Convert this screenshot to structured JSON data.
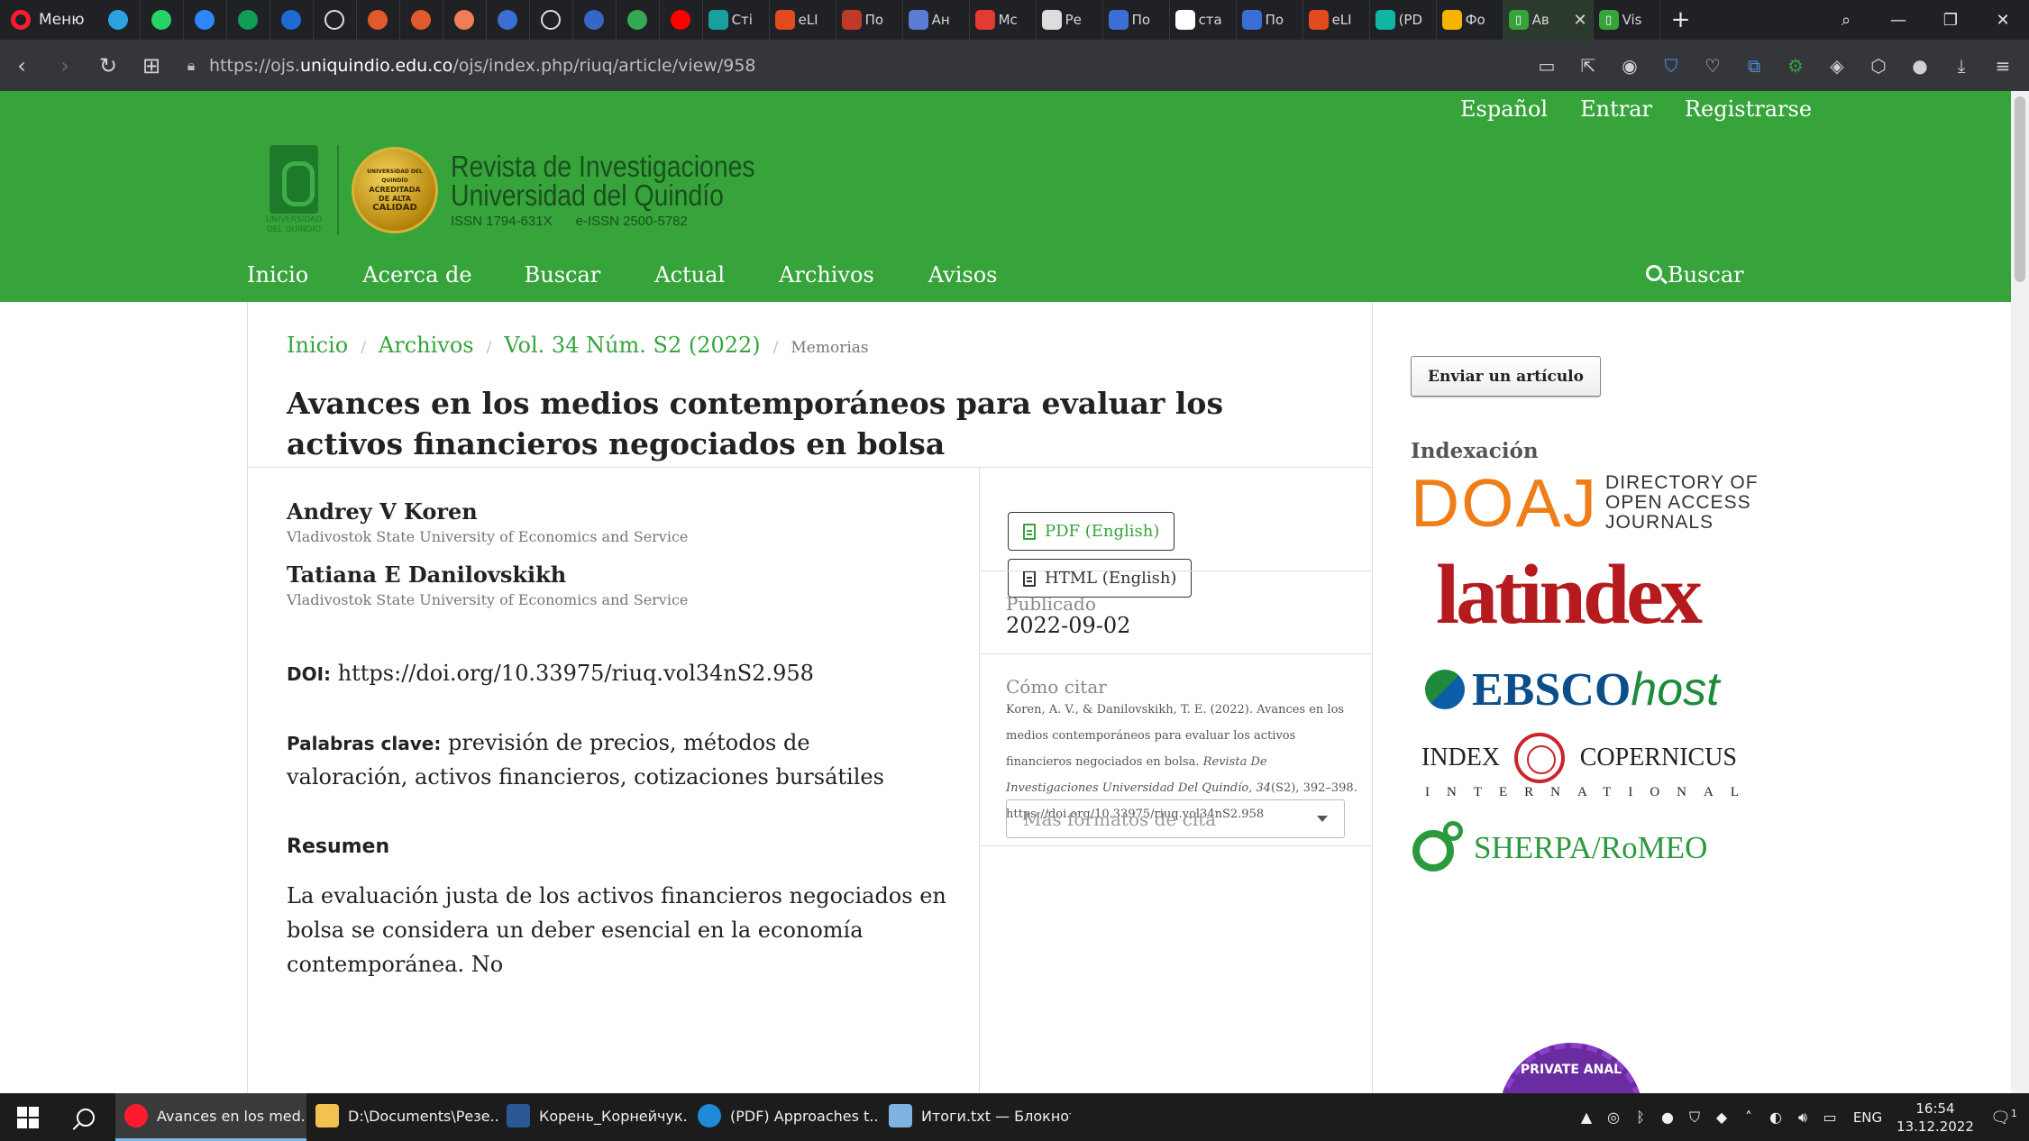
{
  "browser": {
    "menu_label": "Меню",
    "pinned_tabs": [
      {
        "icon": "telegram-icon",
        "color": "#2aa3de"
      },
      {
        "icon": "whatsapp-icon",
        "color": "#25d366"
      },
      {
        "icon": "messenger-icon",
        "color": "#2d88ff"
      },
      {
        "icon": "sheets-icon",
        "color": "#0f9d58"
      },
      {
        "icon": "stack-icon",
        "color": "#1e6bd6"
      },
      {
        "icon": "globe-icon",
        "color": "#ffffff"
      },
      {
        "icon": "feather-icon",
        "color": "#e05a2b"
      },
      {
        "icon": "feather-icon",
        "color": "#e05a2b"
      },
      {
        "icon": "rocket-icon",
        "color": "#f07e54"
      },
      {
        "icon": "banner-icon",
        "color": "#3b6fd6"
      },
      {
        "icon": "tradingview-icon",
        "color": "#ffffff"
      },
      {
        "icon": "rune-icon",
        "color": "#3566c8"
      },
      {
        "icon": "maps-icon",
        "color": "#34a853"
      },
      {
        "icon": "youtube-icon",
        "color": "#ff0000"
      }
    ],
    "tabs": [
      {
        "label": "Сті",
        "icon": "check-icon",
        "color": "#18a0a0"
      },
      {
        "label": "eLI",
        "icon": "elibrary-icon",
        "color": "#e34a1f"
      },
      {
        "label": "По",
        "icon": "rb-icon",
        "color": "#c0392b"
      },
      {
        "label": "Ан",
        "icon": "shield-icon",
        "color": "#5b7bd5"
      },
      {
        "label": "Мс",
        "icon": "pin-icon",
        "color": "#e53935"
      },
      {
        "label": "Ре",
        "icon": "people-icon",
        "color": "#dddddd"
      },
      {
        "label": "По",
        "icon": "banner-icon",
        "color": "#3b6fd6"
      },
      {
        "label": "ста",
        "icon": "globe-icon",
        "color": "#ffffff"
      },
      {
        "label": "По",
        "icon": "banner-icon",
        "color": "#3b6fd6"
      },
      {
        "label": "eLI",
        "icon": "elibrary-icon",
        "color": "#e34a1f"
      },
      {
        "label": "(PD",
        "icon": "researchgate-icon",
        "color": "#11b5a4"
      },
      {
        "label": "Фо",
        "icon": "pinwheel-icon",
        "color": "#f4b400"
      }
    ],
    "active_tab": {
      "label": "Ав",
      "icon": "uq-icon",
      "color": "#36a43b"
    },
    "last_tab": {
      "label": "Vis",
      "icon": "uq-icon",
      "color": "#36a43b"
    },
    "url_prefix": "https://ojs.",
    "url_host": "uniquindio.edu.co",
    "url_path": "/ojs/index.php/riuq/article/view/958"
  },
  "site": {
    "colors": {
      "header_green": "#36a43b",
      "link_green": "#36a43b"
    },
    "user_nav": [
      "Español",
      "Entrar",
      "Registrarse"
    ],
    "journal": {
      "title_line1": "Revista de Investigaciones",
      "title_line2": "Universidad del Quindío",
      "issn": "ISSN 1794-631X",
      "eissn": "e-ISSN 2500-5782",
      "university_logo_text": [
        "UNIVERSIDAD",
        "DEL QUINDÍO"
      ],
      "seal_text": [
        "UNIVERSIDAD DEL QUINDÍO",
        "ACREDITADA",
        "DE ALTA",
        "CALIDAD"
      ]
    },
    "main_nav": [
      "Inicio",
      "Acerca de",
      "Buscar",
      "Actual",
      "Archivos",
      "Avisos"
    ],
    "search_label": "Buscar"
  },
  "article": {
    "breadcrumb": [
      "Inicio",
      "Archivos",
      "Vol. 34 Núm. S2 (2022)"
    ],
    "breadcrumb_current": "Memorias",
    "title": "Avances en los medios contemporáneos para evaluar los activos financieros negociados en bolsa",
    "authors": [
      {
        "name": "Andrey V Koren",
        "affiliation": "Vladivostok State University of Economics and Service"
      },
      {
        "name": "Tatiana E Danilovskikh",
        "affiliation": "Vladivostok State University of Economics and Service"
      }
    ],
    "doi_label": "DOI:",
    "doi": "https://doi.org/10.33975/riuq.vol34nS2.958",
    "keywords_label": "Palabras clave:",
    "keywords": "previsión de precios, métodos de valoración, activos financieros, cotizaciones bursátiles",
    "abstract_heading": "Resumen",
    "abstract_text": "La evaluación justa de los activos financieros negociados en bolsa se considera un deber esencial en la economía contemporánea. No",
    "galleys": [
      "PDF (English)",
      "HTML (English)"
    ],
    "published_label": "Publicado",
    "published_date": "2022-09-02",
    "cite_label": "Cómo citar",
    "citation_plain": "Koren, A. V., & Danilovskikh, T. E. (2022). Avances en los medios contemporáneos para evaluar los activos financieros negociados en bolsa.",
    "citation_journal": "Revista De Investigaciones Universidad Del Quindío, 34",
    "citation_tail": "(S2), 392–398.",
    "citation_doi": "https://doi.org/10.33975/riuq.vol34nS2.958",
    "cite_formats": "Más formatos de cita"
  },
  "sidebar": {
    "submit_label": "Enviar un artículo",
    "indexing_heading": "Indexación",
    "doaj_big": "DOAJ",
    "doaj_small": [
      "DIRECTORY OF",
      "OPEN ACCESS",
      "JOURNALS"
    ],
    "latindex": "latindex",
    "ebsco_bold": "EBSCO",
    "ebsco_italic": "host",
    "copernicus_left": "INDEX",
    "copernicus_right": "COPERNICUS",
    "copernicus_sub": "INTERNATIONAL",
    "sherpa": "SHERPA/RoMEO",
    "badge_partial": "PRIVATE ANAL"
  },
  "taskbar": {
    "apps": [
      {
        "label": "Avances en los med...",
        "icon": "opera-icon",
        "color": "#ff1b2d",
        "active": true
      },
      {
        "label": "D:\\Documents\\Резе...",
        "icon": "folder-icon",
        "color": "#f2c14e",
        "active": false
      },
      {
        "label": "Корень_Корнейчук...",
        "icon": "word-icon",
        "color": "#2b5797",
        "active": false
      },
      {
        "label": "(PDF) Approaches t...",
        "icon": "edge-icon",
        "color": "#1f8ad8",
        "active": false
      },
      {
        "label": "Итоги.txt — Блокнот",
        "icon": "notepad-icon",
        "color": "#7fb3e0",
        "active": false
      }
    ],
    "lang": "ENG",
    "time": "16:54",
    "date": "13.12.2022",
    "notifications": "1"
  }
}
